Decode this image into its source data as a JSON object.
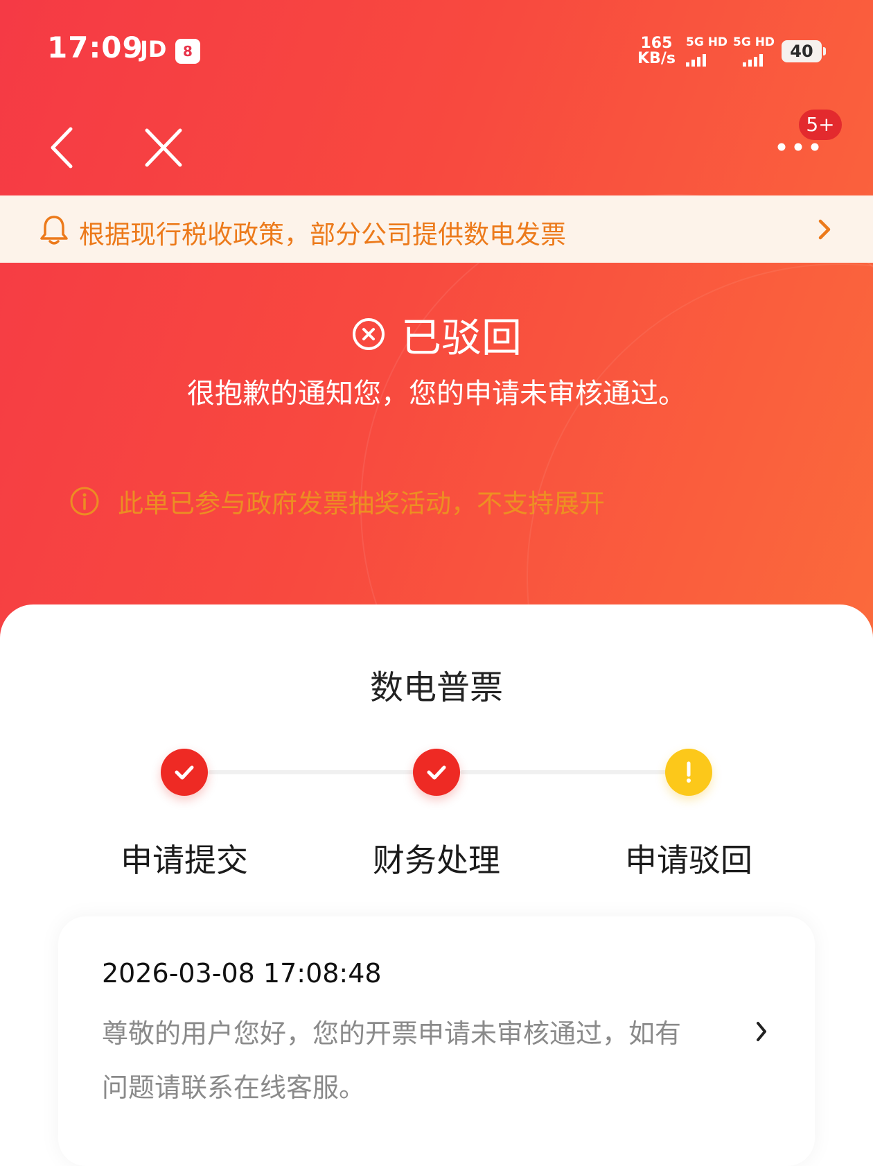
{
  "status_bar": {
    "time": "17:09",
    "carrier": "JD",
    "app_badge": "8",
    "net_speed_value": "165",
    "net_speed_unit": "KB/s",
    "sim1": "5G HD",
    "sim2": "5G HD",
    "battery": "40"
  },
  "nav": {
    "notification_count": "5+"
  },
  "notice": {
    "text": "根据现行税收政策，部分公司提供数电发票"
  },
  "status": {
    "title": "已驳回",
    "description": "很抱歉的通知您，您的申请未审核通过。",
    "lottery_info": "此单已参与政府发票抽奖活动，不支持展开"
  },
  "invoice": {
    "type": "数电普票"
  },
  "steps": [
    {
      "label": "申请提交",
      "state": "done"
    },
    {
      "label": "财务处理",
      "state": "done"
    },
    {
      "label": "申请驳回",
      "state": "warning"
    }
  ],
  "record": {
    "time": "2026-03-08 17:08:48",
    "message": "尊敬的用户您好，您的开票申请未审核通过，如有问题请联系在线客服。"
  },
  "colors": {
    "brand_red": "#f53a45",
    "notice_orange": "#ec7a1b",
    "step_done": "#ee2a24",
    "step_warning": "#fcc81a"
  }
}
